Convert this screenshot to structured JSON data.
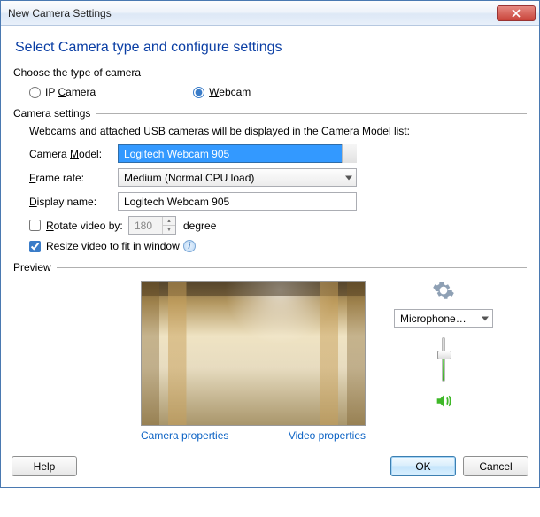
{
  "window": {
    "title": "New Camera Settings"
  },
  "heading": "Select Camera type and configure settings",
  "group_choose": "Choose the type of camera",
  "camera_type": {
    "ip_label": "IP Camera",
    "ip_underline": "C",
    "webcam_label": "ebcam",
    "webcam_underline": "W",
    "selected": "webcam"
  },
  "group_settings": "Camera settings",
  "settings_info": "Webcams and attached USB cameras will be displayed in the Camera Model list:",
  "fields": {
    "camera_model_label": "Camera Model:",
    "camera_model_underline": "M",
    "camera_model_value": "Logitech Webcam 905",
    "frame_rate_label": "Frame rate:",
    "frame_rate_underline": "F",
    "frame_rate_value": "Medium (Normal CPU load)",
    "display_name_label": "Display name:",
    "display_name_underline": "D",
    "display_name_value": "Logitech Webcam 905",
    "rotate_label": "Rotate video by:",
    "rotate_underline": "R",
    "rotate_value": "180",
    "rotate_unit": "degree",
    "rotate_checked": false,
    "resize_label": "Resize video to fit in window",
    "resize_underline_pre": "R",
    "resize_underline": "e",
    "resize_label_post": "size video to fit in window",
    "resize_checked": true
  },
  "group_preview": "Preview",
  "links": {
    "camera_props": "Camera properties",
    "video_props": "Video properties"
  },
  "sidebar": {
    "mic_label": "Microphone…",
    "volume_percent": 60
  },
  "buttons": {
    "help": "Help",
    "ok": "OK",
    "cancel": "Cancel"
  }
}
